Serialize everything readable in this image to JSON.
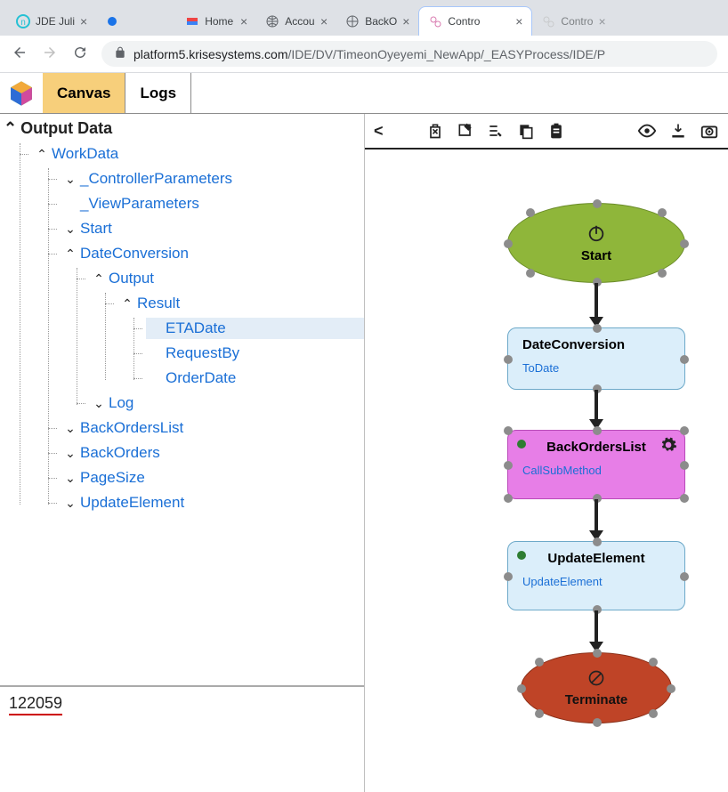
{
  "browser": {
    "tabs": [
      {
        "label": "JDE Juli"
      },
      {
        "label": ""
      },
      {
        "label": "Home"
      },
      {
        "label": "Accou"
      },
      {
        "label": "BackO"
      },
      {
        "label": "Contro"
      },
      {
        "label": "Contro"
      }
    ],
    "url_host": "platform5.krisesystems.com",
    "url_path": "/IDE/DV/TimeonOyeyemi_NewApp/_EASYProcess/IDE/P"
  },
  "app": {
    "tabs": {
      "canvas": "Canvas",
      "logs": "Logs"
    }
  },
  "tree": {
    "root": "Output Data",
    "workdata": "WorkData",
    "controller_params": "_ControllerParameters",
    "view_params": "_ViewParameters",
    "start": "Start",
    "dateconversion": "DateConversion",
    "output": "Output",
    "result": "Result",
    "etadate": "ETADate",
    "requestby": "RequestBy",
    "orderdate": "OrderDate",
    "log": "Log",
    "backorderslist": "BackOrdersList",
    "backorders": "BackOrders",
    "pagesize": "PageSize",
    "updateelement": "UpdateElement"
  },
  "value_pane": "122059",
  "flow": {
    "start": {
      "title": "Start"
    },
    "dateconv": {
      "title": "DateConversion",
      "sub": "ToDate"
    },
    "backorders": {
      "title": "BackOrdersList",
      "sub": "CallSubMethod"
    },
    "updateelem": {
      "title": "UpdateElement",
      "sub": "UpdateElement"
    },
    "terminate": {
      "title": "Terminate"
    }
  }
}
